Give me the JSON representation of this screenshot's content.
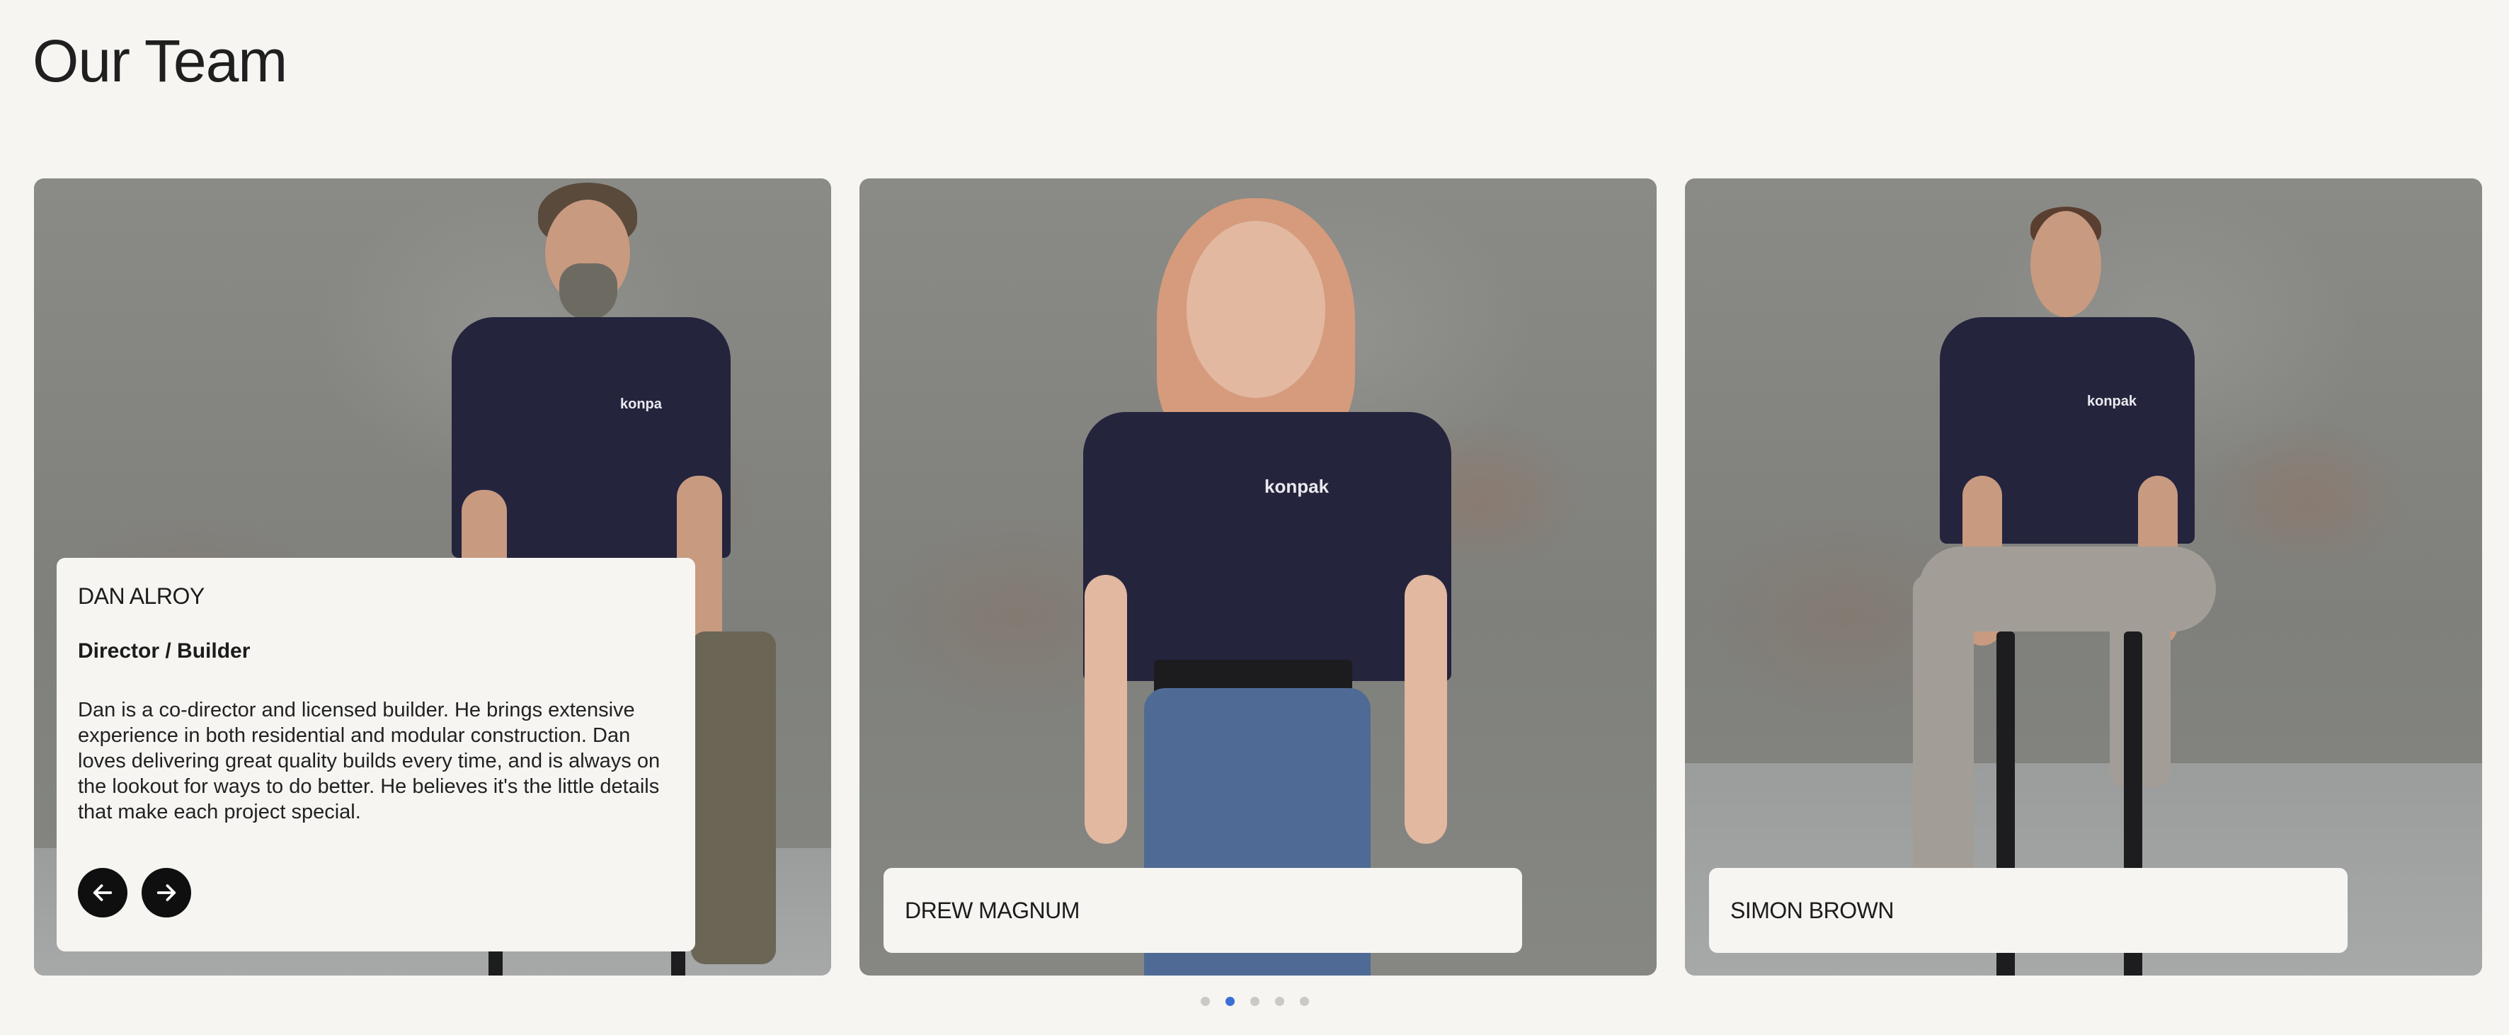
{
  "page": {
    "title": "Our Team"
  },
  "members": [
    {
      "name": "DAN ALROY",
      "role": "Director / Builder",
      "bio": "Dan is a co-director and licensed builder. He brings extensive experience in both residential and modular construction. Dan loves delivering great quality builds every time, and is always on the lookout for ways to do better. He believes it's the little details that make each project special.",
      "shirt_logo": "konpa"
    },
    {
      "name": "DREW MAGNUM",
      "shirt_logo": "konpak"
    },
    {
      "name": "SIMON BROWN",
      "shirt_logo": "konpak"
    }
  ],
  "carousel": {
    "prev_icon": "arrow-left-icon",
    "next_icon": "arrow-right-icon",
    "dot_count": 5,
    "active_dot": 2
  },
  "colors": {
    "background": "#f6f5f2",
    "button": "#0f0f10",
    "active_dot": "#3b6fd6",
    "inactive_dot": "#c9c9c6",
    "shirt": "#24243d"
  }
}
